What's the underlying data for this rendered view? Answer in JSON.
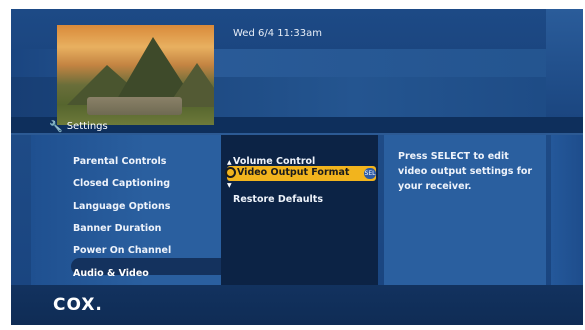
{
  "header": {
    "datetime": "Wed 6/4  11:33am",
    "section_title": "Settings",
    "section_icon": "wrench-icon"
  },
  "menu": {
    "items": [
      {
        "label": "Parental Controls"
      },
      {
        "label": "Closed Captioning"
      },
      {
        "label": "Language Options"
      },
      {
        "label": "Banner Duration"
      },
      {
        "label": "Power On Channel"
      },
      {
        "label": "Audio & Video"
      }
    ],
    "selected": "Audio & Video"
  },
  "submenu": {
    "items": [
      {
        "label": "Volume Control"
      },
      {
        "label": "Video Output Format"
      },
      {
        "label": "Restore Defaults"
      }
    ],
    "highlighted": "Video Output Format",
    "select_badge": "SEL"
  },
  "help": {
    "text": "Press SELECT to edit video output settings for your receiver."
  },
  "footer": {
    "logo": "COX."
  },
  "colors": {
    "background": "#0e2f5c",
    "highlight": "#f2b41d",
    "panel_dark": "#0c2345",
    "panel_light": "#2a5f9f"
  }
}
